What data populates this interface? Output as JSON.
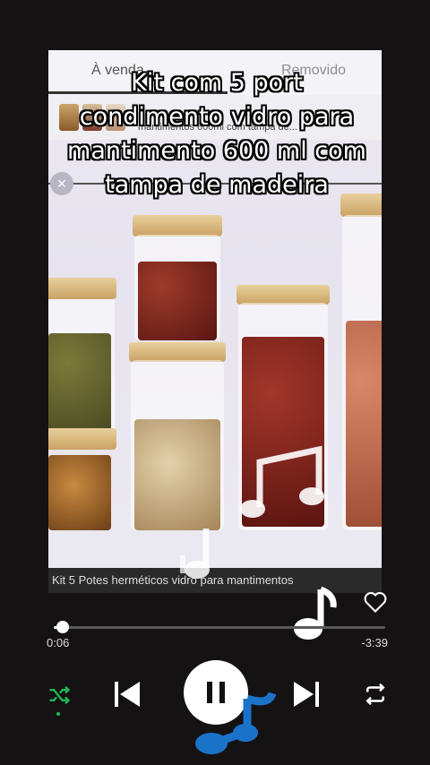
{
  "video": {
    "tabs": {
      "left": "À venda",
      "right": "Removido"
    },
    "product_text": "mantimentos 600ml com tampa de...",
    "caption": "Kit com 5 port condimento vidro para mantimento 600 ml com tampa de madeira",
    "close_symbol": "×"
  },
  "bottom_caption": "Kit 5 Potes herméticos  vidro para mantimentos",
  "player": {
    "elapsed": "0:06",
    "remaining": "-3:39",
    "progress_fraction": 0.027,
    "accent_color": "#1db954"
  },
  "icons": [
    "heart-icon",
    "shuffle-icon",
    "previous-icon",
    "pause-icon",
    "next-icon",
    "repeat-icon",
    "music-note-icon"
  ]
}
